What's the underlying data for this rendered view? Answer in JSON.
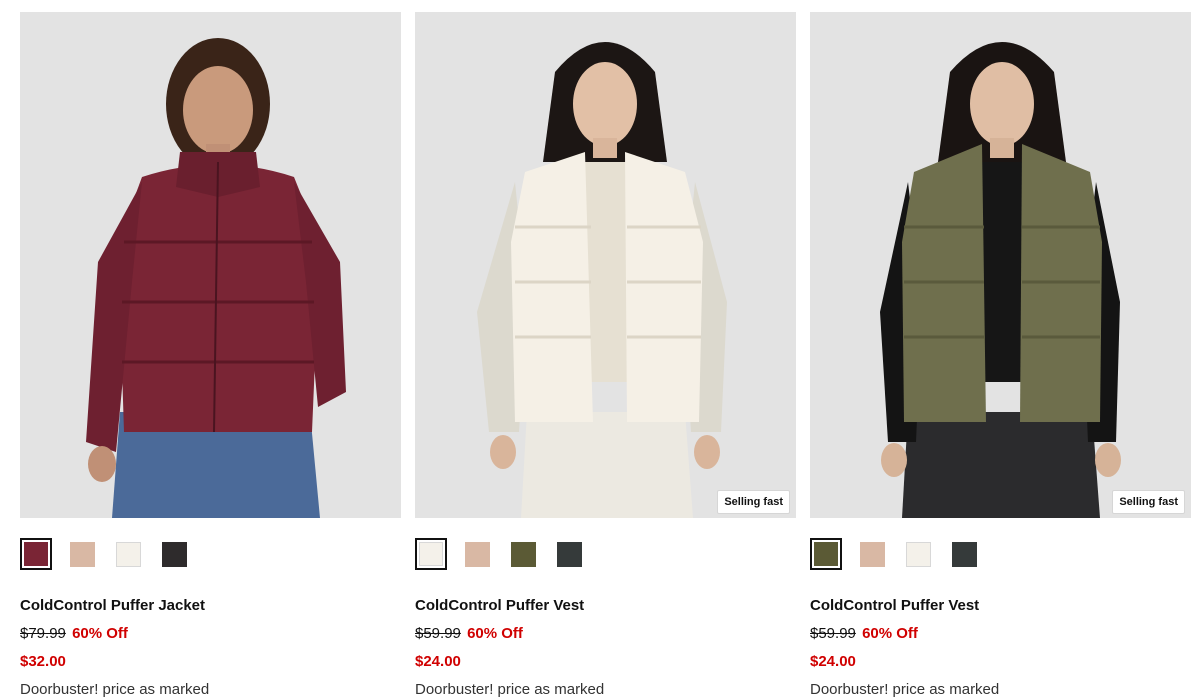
{
  "products": [
    {
      "name": "ColdControl Puffer Jacket",
      "original_price": "$79.99",
      "discount": "60% Off",
      "sale_price": "$32.00",
      "promo": "Doorbuster! price as marked",
      "badge": "",
      "garment_color": "#7a2535",
      "swatches": [
        {
          "color": "#7a2535",
          "selected": true
        },
        {
          "color": "#d9b8a4",
          "selected": false
        },
        {
          "color": "#f4f1ea",
          "selected": false
        },
        {
          "color": "#2e2b2c",
          "selected": false
        }
      ]
    },
    {
      "name": "ColdControl Puffer Vest",
      "original_price": "$59.99",
      "discount": "60% Off",
      "sale_price": "$24.00",
      "promo": "Doorbuster! price as marked",
      "badge": "Selling fast",
      "garment_color": "#f5f0e6",
      "swatches": [
        {
          "color": "#f4f1ea",
          "selected": true
        },
        {
          "color": "#d9b8a4",
          "selected": false
        },
        {
          "color": "#5b5a35",
          "selected": false
        },
        {
          "color": "#353a3a",
          "selected": false
        }
      ]
    },
    {
      "name": "ColdControl Puffer Vest",
      "original_price": "$59.99",
      "discount": "60% Off",
      "sale_price": "$24.00",
      "promo": "Doorbuster! price as marked",
      "badge": "Selling fast",
      "garment_color": "#6f6f4d",
      "swatches": [
        {
          "color": "#5b5a35",
          "selected": true
        },
        {
          "color": "#d9b8a4",
          "selected": false
        },
        {
          "color": "#f4f1ea",
          "selected": false
        },
        {
          "color": "#353a3a",
          "selected": false
        }
      ]
    }
  ]
}
